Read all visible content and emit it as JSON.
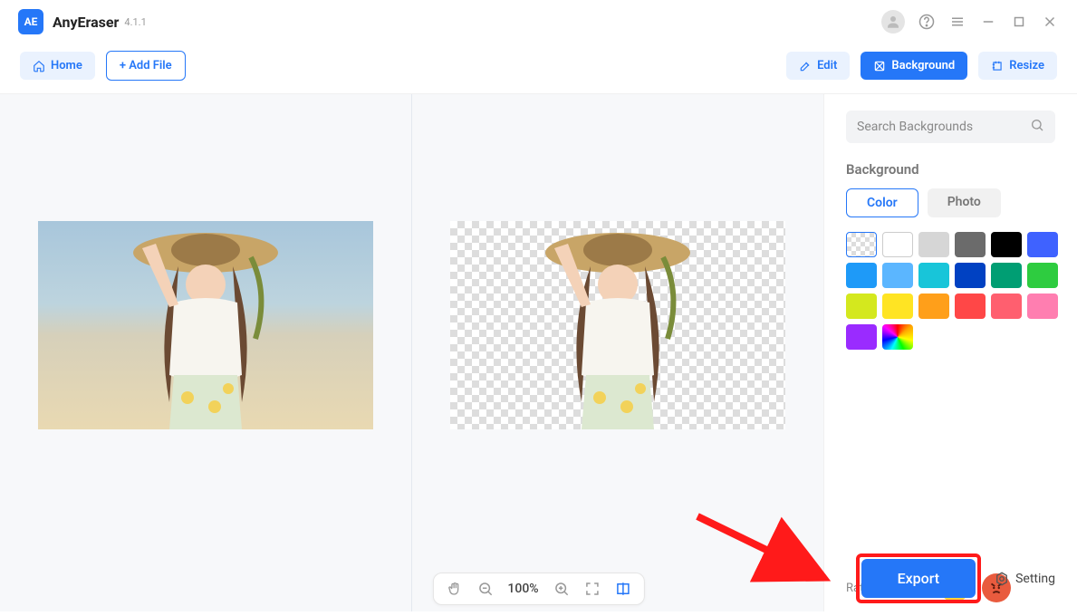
{
  "app": {
    "name": "AnyEraser",
    "version": "4.1.1"
  },
  "toolbar": {
    "home": "Home",
    "addFile": "+ Add File",
    "edit": "Edit",
    "background": "Background",
    "resize": "Resize"
  },
  "sidebar": {
    "searchPlaceholder": "Search Backgrounds",
    "sectionTitle": "Background",
    "tabs": {
      "color": "Color",
      "photo": "Photo"
    },
    "colors": [
      "transparent",
      "#ffffff",
      "#d6d6d6",
      "#6b6b6b",
      "#000000",
      "#3f62ff",
      "#1e9af8",
      "#5bb6ff",
      "#18c5d9",
      "#0041c2",
      "#009e73",
      "#2ecc40",
      "#d4e81e",
      "#ffe423",
      "#ff9f1a",
      "#ff4747",
      "#ff5f6f",
      "#ff7eb0",
      "#9a2bff",
      "rainbow"
    ]
  },
  "rate": {
    "label": "Rate this result:"
  },
  "zoom": {
    "value": "100%"
  },
  "footer": {
    "export": "Export",
    "setting": "Setting"
  }
}
